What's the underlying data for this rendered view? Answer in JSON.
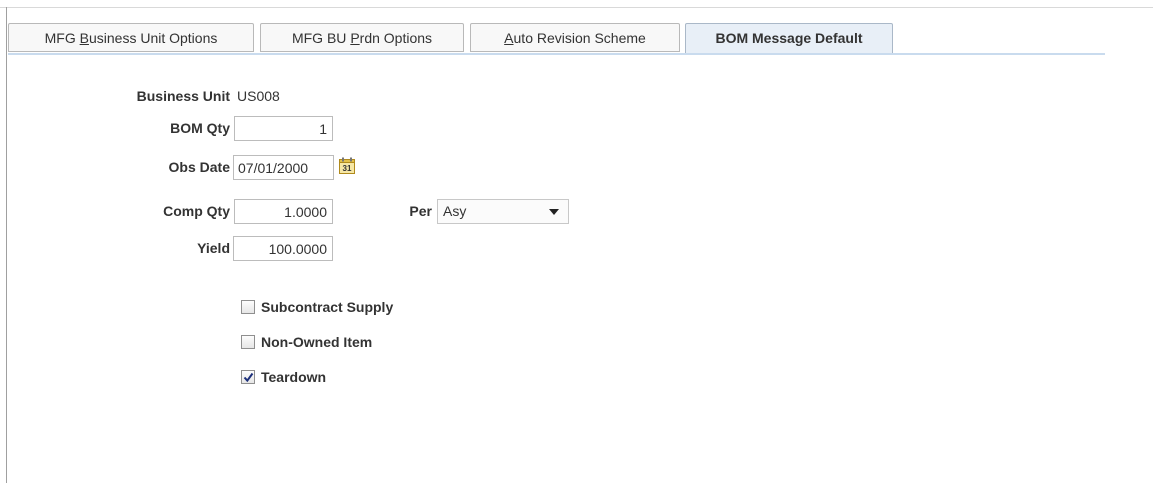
{
  "tabs": [
    {
      "pre": "MFG ",
      "key": "B",
      "post": "usiness Unit Options"
    },
    {
      "pre": "MFG BU ",
      "key": "P",
      "post": "rdn Options"
    },
    {
      "pre": "",
      "key": "A",
      "post": "uto Revision Scheme"
    },
    {
      "pre": "BOM Message Default",
      "key": "",
      "post": ""
    }
  ],
  "form": {
    "business_unit_label": "Business Unit",
    "business_unit_value": "US008",
    "bom_qty_label": "BOM Qty",
    "bom_qty_value": "1",
    "obs_date_label": "Obs Date",
    "obs_date_value": "07/01/2000",
    "calendar_icon_text": "31",
    "comp_qty_label": "Comp Qty",
    "comp_qty_value": "1.0000",
    "per_label": "Per",
    "per_value": "Asy",
    "yield_label": "Yield",
    "yield_value": "100.0000"
  },
  "checkboxes": [
    {
      "label": "Subcontract Supply",
      "checked": false
    },
    {
      "label": "Non-Owned Item",
      "checked": false
    },
    {
      "label": "Teardown",
      "checked": true
    }
  ],
  "colors": {
    "active_tab_bg": "#e8eff7",
    "tab_underline": "#c9dbee",
    "calendar_icon": "#e2c04a"
  }
}
